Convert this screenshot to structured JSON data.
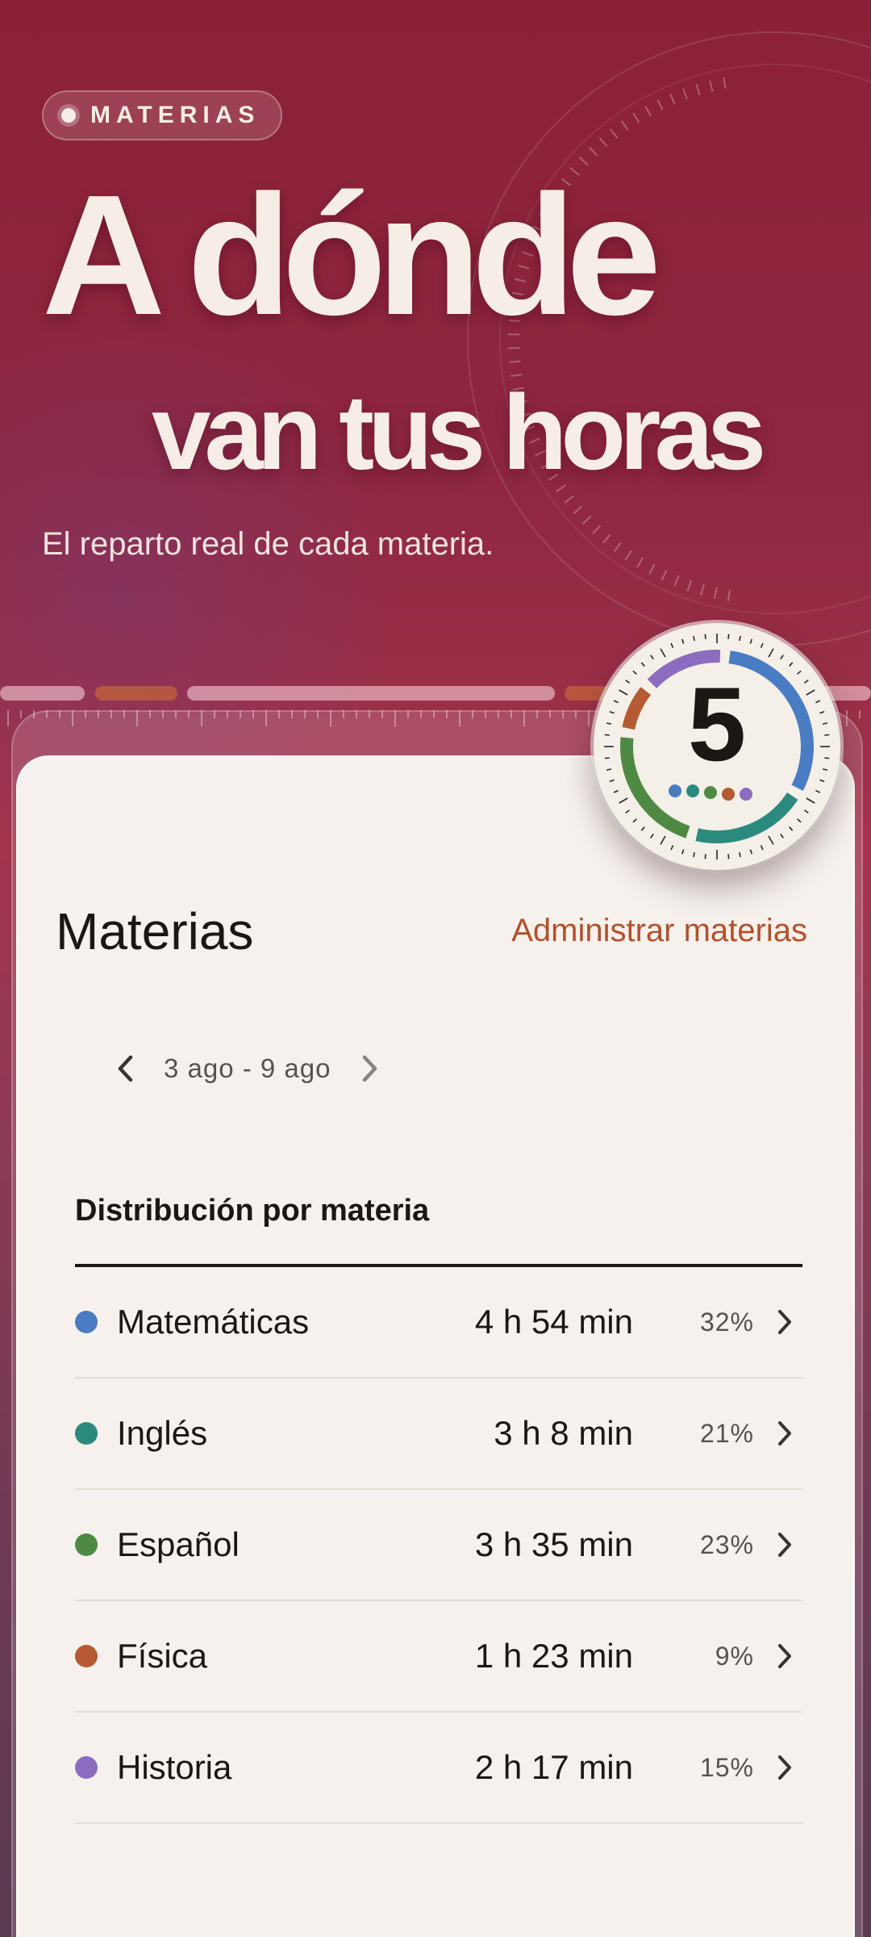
{
  "header": {
    "pill_label": "MATERIAS",
    "title_line1": "A dónde",
    "title_line2": "van tus horas",
    "subtitle": "El reparto real de cada materia."
  },
  "badge": {
    "count": "5"
  },
  "card": {
    "title": "Materias",
    "manage_link": "Administrar materias",
    "week_range": "3 ago - 9 ago",
    "distribution_title": "Distribución por materia",
    "subjects": [
      {
        "name": "Matemáticas",
        "time": "4 h 54 min",
        "percent": "32%",
        "color": "#4a7cc4"
      },
      {
        "name": "Inglés",
        "time": "3 h 8 min",
        "percent": "21%",
        "color": "#2a8a7e"
      },
      {
        "name": "Español",
        "time": "3 h 35 min",
        "percent": "23%",
        "color": "#4f8a45"
      },
      {
        "name": "Física",
        "time": "1 h 23 min",
        "percent": "9%",
        "color": "#b55a33"
      },
      {
        "name": "Historia",
        "time": "2 h 17 min",
        "percent": "15%",
        "color": "#8b6cc0"
      }
    ]
  },
  "colors": {
    "accent": "#b4502c",
    "background_top": "#8b2138",
    "card": "#f6f1ec"
  },
  "icons": [
    "chevron-left-icon",
    "chevron-right-icon",
    "row-chevron-icon"
  ]
}
